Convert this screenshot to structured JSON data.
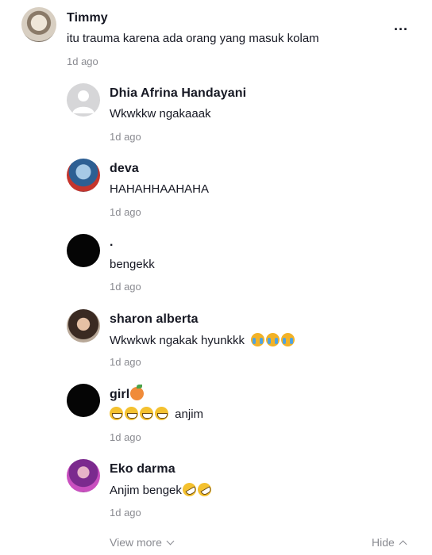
{
  "main_comment": {
    "username": "Timmy",
    "text": "itu trauma karena ada orang yang masuk kolam",
    "time": "1d ago",
    "more_label": "..."
  },
  "replies": [
    {
      "username": "Dhia Afrina Handayani",
      "text": "Wkwkkw ngakaaak",
      "time": "1d ago"
    },
    {
      "username": "deva",
      "text": "HAHAHHAAHAHA",
      "time": "1d ago"
    },
    {
      "username": ".",
      "text": "bengekk",
      "time": "1d ago"
    },
    {
      "username": "sharon alberta",
      "text": "Wkwkwk ngakak hyunkkk",
      "time": "1d ago",
      "text_emojis": [
        "crying-face",
        "crying-face",
        "crying-face"
      ]
    },
    {
      "username": "girl",
      "username_emoji": "peach",
      "text": "anjim",
      "time": "1d ago",
      "text_leading_emojis": [
        "grinning-sweat-face",
        "grinning-sweat-face",
        "grinning-sweat-face",
        "grinning-sweat-face"
      ]
    },
    {
      "username": "Eko darma",
      "text": "Anjim bengek",
      "time": "1d ago",
      "text_emojis": [
        "rofl-face",
        "rofl-face"
      ]
    }
  ],
  "footer": {
    "view_more": "View more",
    "hide": "Hide"
  },
  "colors": {
    "text": "#161823",
    "muted": "#8a8b91",
    "background": "#ffffff"
  }
}
